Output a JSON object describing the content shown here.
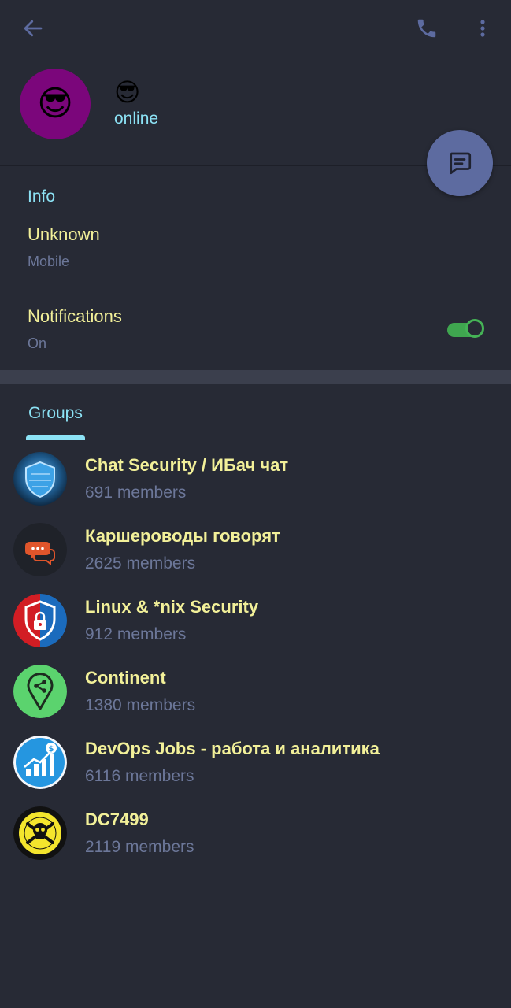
{
  "header": {
    "back_icon": "arrow-left-icon",
    "call_icon": "phone-icon",
    "more_icon": "more-vertical-icon",
    "accent_color": "#5d6ba0"
  },
  "profile": {
    "avatar_emoji": "😎",
    "name": "😎",
    "status": "online",
    "avatar_color": "#7b067b"
  },
  "fab": {
    "icon": "message-icon"
  },
  "info": {
    "title": "Info",
    "phone_value": "Unknown",
    "phone_label": "Mobile",
    "notifications_label": "Notifications",
    "notifications_value": "On",
    "notifications_enabled": true
  },
  "tabs": {
    "groups_label": "Groups"
  },
  "groups": [
    {
      "name": "Chat Security / ИБач чат",
      "members": "691 members",
      "icon": "security-shield-avatar"
    },
    {
      "name": "Каршероводы говорят",
      "members": "2625 members",
      "icon": "chat-bubbles-avatar"
    },
    {
      "name": "Linux & *nix Security",
      "members": "912 members",
      "icon": "lock-shield-avatar"
    },
    {
      "name": "Continent",
      "members": "1380 members",
      "icon": "map-pin-avatar"
    },
    {
      "name": "DevOps Jobs - работа и аналитика",
      "members": "6116 members",
      "icon": "growth-chart-avatar"
    },
    {
      "name": "DC7499",
      "members": "2119 members",
      "icon": "skull-crossbones-avatar"
    }
  ],
  "colors": {
    "background": "#272a35",
    "title_text": "#f2f099",
    "accent_text": "#8ce2f5",
    "secondary_text": "#6c7799",
    "toggle_on": "#3fa64f"
  }
}
